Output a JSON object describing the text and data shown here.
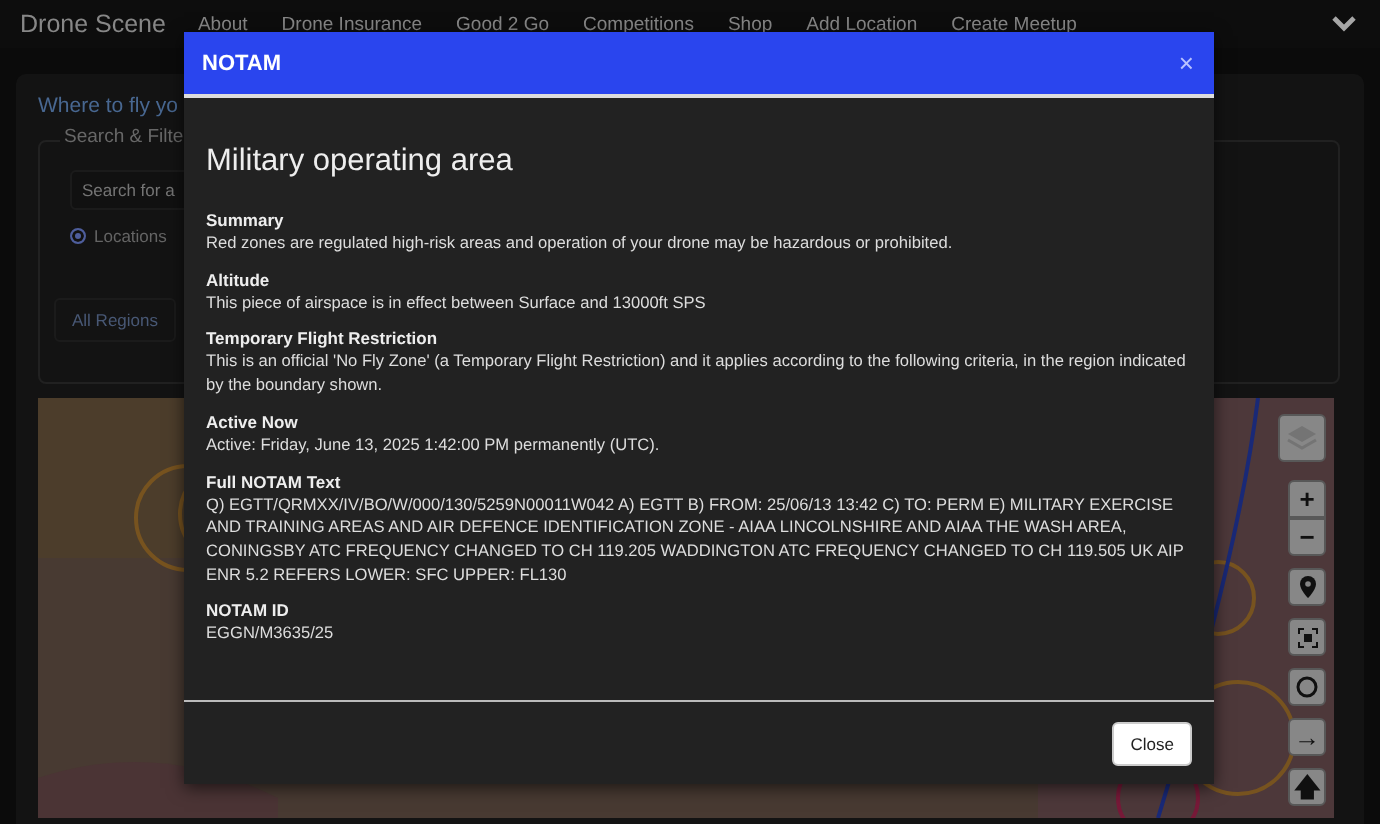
{
  "navbar": {
    "brand": "Drone Scene",
    "links": [
      "About",
      "Drone Insurance",
      "Good 2 Go",
      "Competitions",
      "Shop",
      "Add Location",
      "Create Meetup"
    ]
  },
  "page": {
    "heading": "Where to fly yo",
    "filter": {
      "legend": "Search & Filte",
      "search": {
        "placeholder": "Search for a"
      },
      "radio": {
        "label": "Locations",
        "selected": true
      },
      "region": "All Regions"
    },
    "map": {
      "kind": "picture",
      "controls": [
        {
          "kind": "layers"
        },
        {
          "kind": "zoom-in",
          "label": "+"
        },
        {
          "kind": "zoom-out",
          "label": "−"
        },
        {
          "kind": "locate"
        },
        {
          "kind": "fullscreen"
        },
        {
          "kind": "circle"
        },
        {
          "kind": "arrow",
          "label": "→"
        },
        {
          "kind": "up",
          "label": "🡅"
        }
      ]
    }
  },
  "modal": {
    "title": "NOTAM",
    "close_symbol": "×",
    "heading": "Military operating area",
    "sections": [
      {
        "label": "Summary",
        "text": "Red zones are regulated high-risk areas and operation of your drone may be hazardous or prohibited."
      },
      {
        "label": "Altitude",
        "text": "This piece of airspace is in effect between Surface and 13000ft SPS"
      },
      {
        "label": "Temporary Flight Restriction",
        "text": "This is an official 'No Fly Zone' (a Temporary Flight Restriction) and it applies according to the following criteria, in the region indicated by the boundary shown."
      },
      {
        "label": "Active Now",
        "text": "Active: Friday, June 13, 2025 1:42:00 PM permanently (UTC)."
      },
      {
        "label": "Full NOTAM Text",
        "text": "Q) EGTT/QRMXX/IV/BO/W/000/130/5259N00011W042 A) EGTT B) FROM: 25/06/13 13:42 C) TO: PERM E) MILITARY EXERCISE AND TRAINING AREAS AND AIR DEFENCE IDENTIFICATION ZONE - AIAA LINCOLNSHIRE AND AIAA THE WASH AREA, CONINGSBY ATC FREQUENCY CHANGED TO CH 119.205 WADDINGTON ATC FREQUENCY CHANGED TO CH 119.505 UK AIP ENR 5.2 REFERS LOWER: SFC UPPER: FL130"
      },
      {
        "label": "NOTAM ID",
        "text": "EGGN/M3635/25"
      }
    ],
    "button": "Close"
  }
}
